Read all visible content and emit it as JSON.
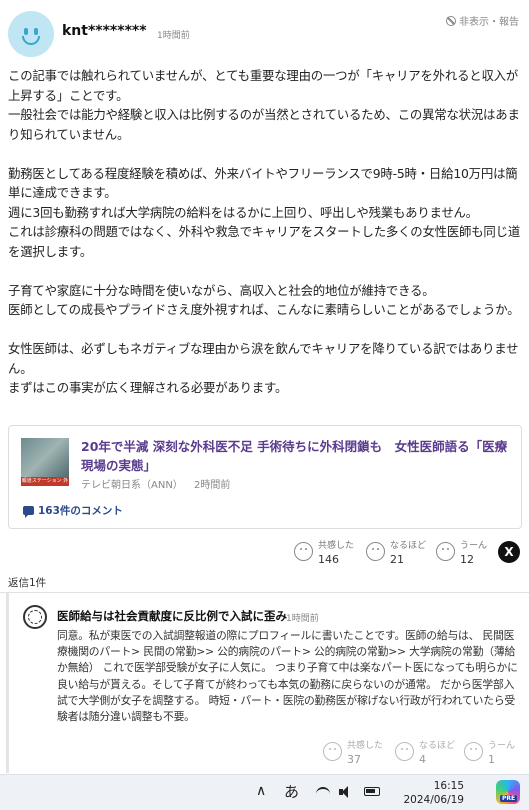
{
  "comment": {
    "username": "knt********",
    "time": "1時間前",
    "hide_report": "非表示・報告",
    "paragraphs": [
      "この記事では触れられていませんが、とても重要な理由の一つが「キャリアを外れると収入が上昇する」ことです。",
      "一般社会では能力や経験と収入は比例するのが当然とされているため、この異常な状況はあまり知られていません。",
      "",
      "勤務医としてある程度経験を積めば、外来バイトやフリーランスで9時-5時・日給10万円は簡単に達成できます。",
      "週に3回も勤務すれば大学病院の給料をはるかに上回り、呼出しや残業もありません。",
      "これは診療科の問題ではなく、外科や救急でキャリアをスタートした多くの女性医師も同じ道を選択します。",
      "",
      "子育てや家庭に十分な時間を使いながら、高収入と社会的地位が維持できる。",
      "医師としての成長やプライドさえ度外視すれば、こんなに素晴らしいことがあるでしょうか。",
      "",
      "女性医師は、必ずしもネガティブな理由から涙を飲んでキャリアを降りている訳ではありません。",
      "まずはこの事実が広く理解される必要があります。"
    ],
    "article": {
      "title": "20年で半減 深刻な外科医不足 手術待ちに外科閉鎖も　女性医師語る「医療現場の実態」",
      "thumb_tag": "報道ステーション 外科医不足",
      "source": "テレビ朝日系（ANN）",
      "time": "2時間前",
      "comments": "163件のコメント"
    },
    "reactions": [
      {
        "label": "共感した",
        "count": "146"
      },
      {
        "label": "なるほど",
        "count": "21"
      },
      {
        "label": "うーん",
        "count": "12"
      }
    ],
    "share_x": "X"
  },
  "replies_count": "返信1件",
  "reply": {
    "username": "医師給与は社会貢献度に反比例で入試に歪み",
    "time": "1時間前",
    "text": "同意。私が東医での入試調整報道の際にプロフィールに書いたことです。医師の給与は、 民間医療機関のパート> 民間の常勤>> 公的病院のパート> 公的病院の常勤>> 大学病院の常勤（薄給か無給） これで医学部受験が女子に人気に。 つまり子育て中は楽なパート医になっても明らかに良い給与が貰える。そして子育てが終わっても本気の勤務に戻らないのが通常。 だから医学部入試で大学側が女子を調整する。 時短・パート・医院の勤務医が稼げない行政が行われていたら受験者は随分違い調整も不要。",
    "reactions": [
      {
        "label": "共感した",
        "count": "37"
      },
      {
        "label": "なるほど",
        "count": "4"
      },
      {
        "label": "うーん",
        "count": "1"
      }
    ]
  },
  "taskbar": {
    "chevron": "∧",
    "ime": "あ",
    "clock_time": "16:15",
    "clock_date": "2024/06/19",
    "copilot_badge": "PRE"
  }
}
